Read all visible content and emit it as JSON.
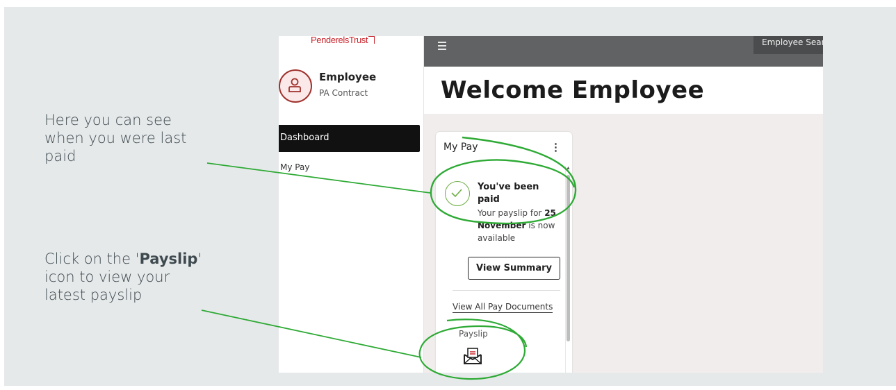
{
  "callouts": {
    "last_paid": "Here you can see when you were last paid",
    "payslip_pre": "Click on the '",
    "payslip_bold": "Payslip",
    "payslip_post": "' icon to view your latest payslip"
  },
  "logo": {
    "text": "Penderels",
    "trust": "Trust"
  },
  "user": {
    "name": "Employee",
    "contract": "PA Contract"
  },
  "sidebar": {
    "items": [
      {
        "label": "Dashboard",
        "active": true
      },
      {
        "label": "My Pay",
        "active": false
      }
    ]
  },
  "topbar": {
    "search_label": "Employee Sear"
  },
  "main": {
    "welcome": "Welcome Employee"
  },
  "card": {
    "title": "My Pay",
    "menu_glyph": "⋮",
    "paid_title": "You've been paid",
    "desc_pre": "Your payslip for",
    "desc_date": "25 November",
    "desc_post": "is now available",
    "view_summary": "View Summary",
    "view_all": "View All Pay Documents",
    "payslip_label": "Payslip"
  },
  "colors": {
    "highlight": "#2eaa35",
    "brand": "#c9252c",
    "topbar": "#606263",
    "backdrop": "#e6e9ea"
  }
}
